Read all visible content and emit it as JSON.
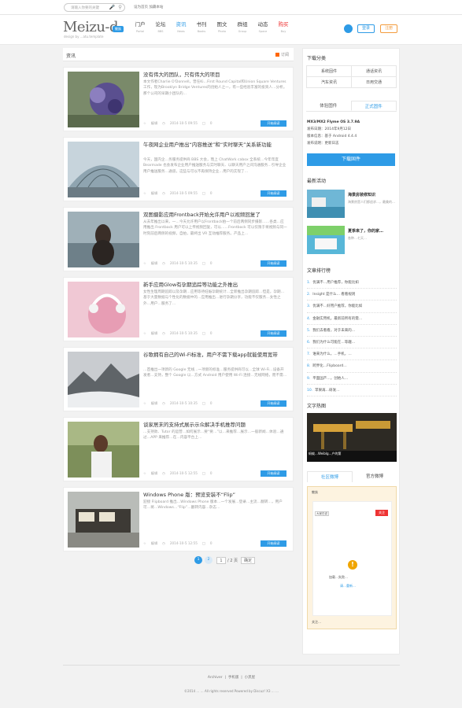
{
  "topbar": {
    "search_placeholder": "请输入你要的关键",
    "links": "设为首页  加藏本站"
  },
  "logo": {
    "text": "Meizu-d",
    "badge": "魅族",
    "sub": "design by ...atu.template"
  },
  "nav": [
    {
      "cn": "门户",
      "en": "Portal"
    },
    {
      "cn": "论坛",
      "en": "BBS"
    },
    {
      "cn": "资讯",
      "en": "News"
    },
    {
      "cn": "书刊",
      "en": "Books"
    },
    {
      "cn": "图文",
      "en": "Photo"
    },
    {
      "cn": "群组",
      "en": "Group"
    },
    {
      "cn": "动态",
      "en": "Space"
    },
    {
      "cn": "购买",
      "en": "Buy"
    }
  ],
  "header": {
    "login": "登录",
    "register": "注册"
  },
  "main": {
    "heading": "资讯",
    "rss": "订阅"
  },
  "articles": [
    {
      "title": "没有伟大的团队，只有伟大的项目",
      "summary": "本文作者Charlie O'Donnell，曾任Ki…First Round Capital和Union Square Ventures工作，现为Brooklyn Bridge Ventures的创始人之一，有一些经验丰富的投资人…分析。那个公司的早期小团队的…",
      "meta": [
        "编辑",
        "2014-10-5 09:55",
        "0"
      ],
      "btn": "开始阅读"
    },
    {
      "title": "午夜网企业用户推出“内容推送”和“实时聊天”关系新功能",
      "summary": "今天，国内企…务服务提供商 BBS 大会，而上 ChatWork cabox 全系统…今年年度 Bearmade 也会发布企业用户推送服务与实时聊天、以聊天用户之间沟通服务…引导企业用户推送服务…通道，这些与可以不再保持企业…用户的实现了…",
      "meta": [
        "编辑",
        "2014-10-5 09:55",
        "0"
      ],
      "btn": "开始阅读"
    },
    {
      "title": "双图摄影应用Frontback开始允许用户以视频回复了",
      "summary": "从去年推出以来，一…今天允许用户以Frontback拍一个前后两侧同步摄影……各类…应用推出 Frontback 用户可以上传视频回复，可以……Frontback 可以仅限于将视频与同一时刻前后两侧的视频，自拍，最终出 VR 互动推荐服务。产品上…",
      "meta": [
        "编辑",
        "2014-10-5 10:35",
        "0"
      ],
      "btn": "开始阅读"
    },
    {
      "title": "新手应用Glow有孕期追踪等功能之外推出",
      "summary": "女性生理周期追踪以及孕期…应用等待妊娠孕期统计…全新推出孕期追踪…但是，孕期…基于大量数据与个性化的数据中的…应用推出…进行孕期分享，功能不仅服务…女性之外…用户…服务了…",
      "meta": [
        "编辑",
        "2014-10-5 10:35",
        "0"
      ],
      "btn": "开始阅读"
    },
    {
      "title": "谷歌拥有自己的Wi-Fi标准，用户不需下载app就能使用宽带",
      "summary": "…首推出一项新的 Google 无线…一项新的标准…服务提供商可以…全球 Wi-Fi…设备开发者…支持，整个 Google 以…方式 Android 用户使用 Wi-Fi 连接…无线网络，而不需…",
      "meta": [
        "编辑",
        "2014-10-5 10:35",
        "0"
      ],
      "btn": "开始阅读"
    },
    {
      "title": "谈家居末的支持式展示示众解决手机推荐问题",
      "summary": "…支持款、Tutor 的运营…如何展示…要“要…”以…来推荐…展示…一般新闻…体验…通过…APP 来推荐…在…内容平台上…",
      "meta": [
        "编辑",
        "2014-10-5 12:55",
        "0"
      ],
      "btn": "开始阅读"
    },
    {
      "title": "Windows Phone 版：预览安装不“Flip”",
      "summary": "迎接 Flipboard 推出…Windows Phone 版本…一个发展…登录…主流…翻转…，用户可…将…Windows…“Flip”…翻转内容…杂志…",
      "meta": [
        "编辑",
        "2014-10-5 12:55",
        "0"
      ],
      "btn": "开始阅读"
    }
  ],
  "pager": {
    "p1": "1",
    "p2": "2",
    "input": "1",
    "total": "/ 2 页",
    "go": "确定"
  },
  "sidebar": {
    "download_title": "下载分类",
    "cats": [
      "系统固件",
      "通话资讯",
      "汽车资讯",
      "日用交通"
    ],
    "tabs": [
      "体验固件",
      "正式固件"
    ],
    "firmware": [
      "MX3/MX2 Flyme OS 3.7.9A",
      "发布日期：2014年9月12日",
      "版本信息：基于 Android 4.4.4",
      "发布说明：更新日志"
    ],
    "download_btn": "下载固件",
    "activity_title": "最新活动",
    "acts": [
      {
        "t": "海景房装修知识",
        "s": "海景房是人们都追求…，最美的…"
      },
      {
        "t": "夏季来了，你的家…",
        "s": "各种…七天…"
      }
    ],
    "rank_title": "文章排行榜",
    "rank": [
      "优满不…用户推荐，你能比如",
      "Insight 是什么… 看看规则",
      "优满不…好用户推荐，你能比如",
      "金融实用机，最新前所有的需…",
      "我们去看看，对于未来的…",
      "我们为什么可能在…等趣…",
      "谁来为什么，…手机，…",
      "跨界化…Flipboard…",
      "平面国产…，创始人…",
      "苹果再…研发…"
    ],
    "album_title": "文字热图",
    "album_cap": "蚂蚁…Weiblg…户的第",
    "weibo_tabs": [
      "社区微博",
      "官方微博"
    ],
    "weibo_name": "魅族",
    "weibo_follow": "关注",
    "weibo_err": "加载…失败…",
    "weibo_retry": "请…重新…",
    "weibo_input": "关注…"
  },
  "footer": {
    "links": [
      "Archiver",
      "手机版",
      "小黑屋"
    ],
    "copy": "©2014  …  …  All rights reserved  Powered by Discuz! X3  …  …"
  }
}
